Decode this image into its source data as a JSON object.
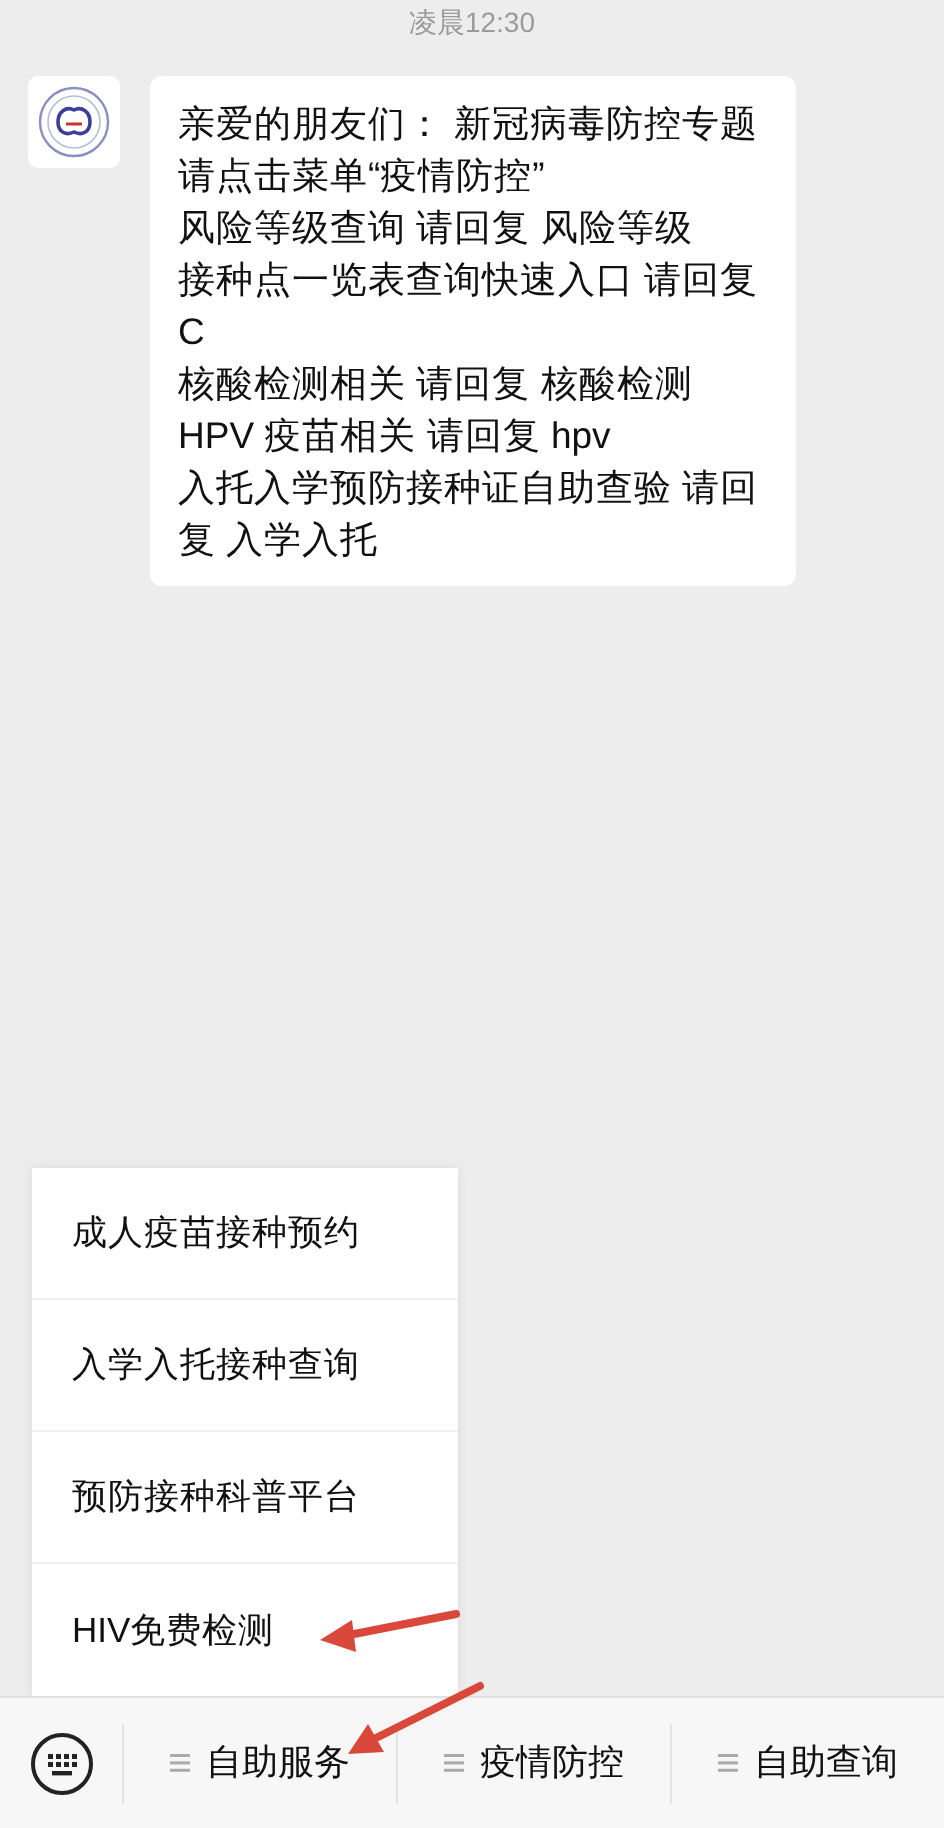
{
  "timestamp": "凌晨12:30",
  "message": {
    "lines": [
      "亲爱的朋友们：  新冠病毒防控专题请点击菜单“疫情防控”",
      "风险等级查询 请回复 风险等级",
      "接种点一览表查询快速入口 请回复 C",
      "核酸检测相关 请回复 核酸检测",
      "HPV 疫苗相关 请回复 hpv",
      "入托入学预防接种证自助查验 请回复 入学入托"
    ]
  },
  "submenu": {
    "items": [
      {
        "label": "成人疫苗接种预约"
      },
      {
        "label": "入学入托接种查询"
      },
      {
        "label": "预防接种科普平台"
      },
      {
        "label": "HIV免费检测"
      }
    ]
  },
  "menu_bar": {
    "items": [
      {
        "label": "自助服务"
      },
      {
        "label": "疫情防控"
      },
      {
        "label": "自助查询"
      }
    ]
  }
}
